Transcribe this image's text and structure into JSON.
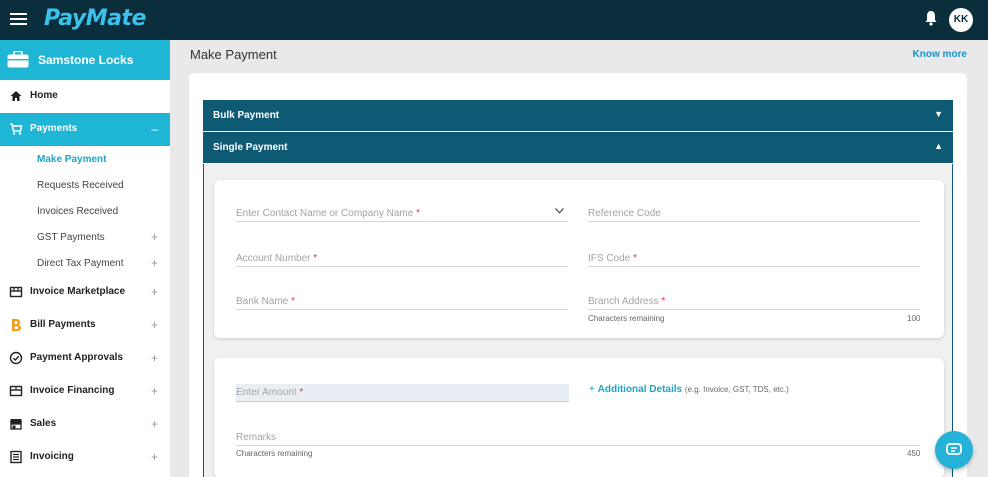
{
  "app": {
    "brand": "PayMate",
    "user_initials": "KK"
  },
  "sidebar": {
    "company": "Samstone Locks",
    "items": [
      {
        "label": "Home",
        "icon": "home-icon"
      },
      {
        "label": "Payments",
        "icon": "cart-icon",
        "toggle": "–",
        "active": true,
        "children": [
          {
            "label": "Make Payment",
            "current": true
          },
          {
            "label": "Requests Received"
          },
          {
            "label": "Invoices Received"
          },
          {
            "label": "GST Payments",
            "toggle": "+"
          },
          {
            "label": "Direct Tax Payment",
            "toggle": "+"
          }
        ]
      },
      {
        "label": "Invoice Marketplace",
        "icon": "marketplace-icon",
        "toggle": "+"
      },
      {
        "label": "Bill Payments",
        "icon": "bill-icon",
        "toggle": "+"
      },
      {
        "label": "Payment Approvals",
        "icon": "check-circle-icon",
        "toggle": "+"
      },
      {
        "label": "Invoice Financing",
        "icon": "financing-icon",
        "toggle": "+"
      },
      {
        "label": "Sales",
        "icon": "store-icon",
        "toggle": "+"
      },
      {
        "label": "Invoicing",
        "icon": "invoice-icon",
        "toggle": "+"
      }
    ]
  },
  "main": {
    "title": "Make Payment",
    "know_more": "Know more",
    "accordion": {
      "bulk": "Bulk Payment",
      "single": "Single Payment"
    },
    "form": {
      "contact": "Enter Contact Name or Company Name",
      "reference": "Reference Code",
      "account": "Account Number",
      "ifsc": "IFS Code",
      "bank": "Bank Name",
      "branch": "Branch Address",
      "branch_helper": "Characters remaining",
      "branch_count": "100",
      "amount": "Enter Amount",
      "additional_plus": "+",
      "additional_link": "Additional Details",
      "additional_hint": "(e.g. Invoice, GST, TDS, etc.)",
      "remarks": "Remarks",
      "remarks_helper": "Characters remaining",
      "remarks_count": "450",
      "required_mark": "*"
    }
  },
  "colors": {
    "topbar": "#0b2e3d",
    "accent": "#1fb6d6",
    "accordion": "#0e5a74",
    "required": "#e0334c"
  }
}
